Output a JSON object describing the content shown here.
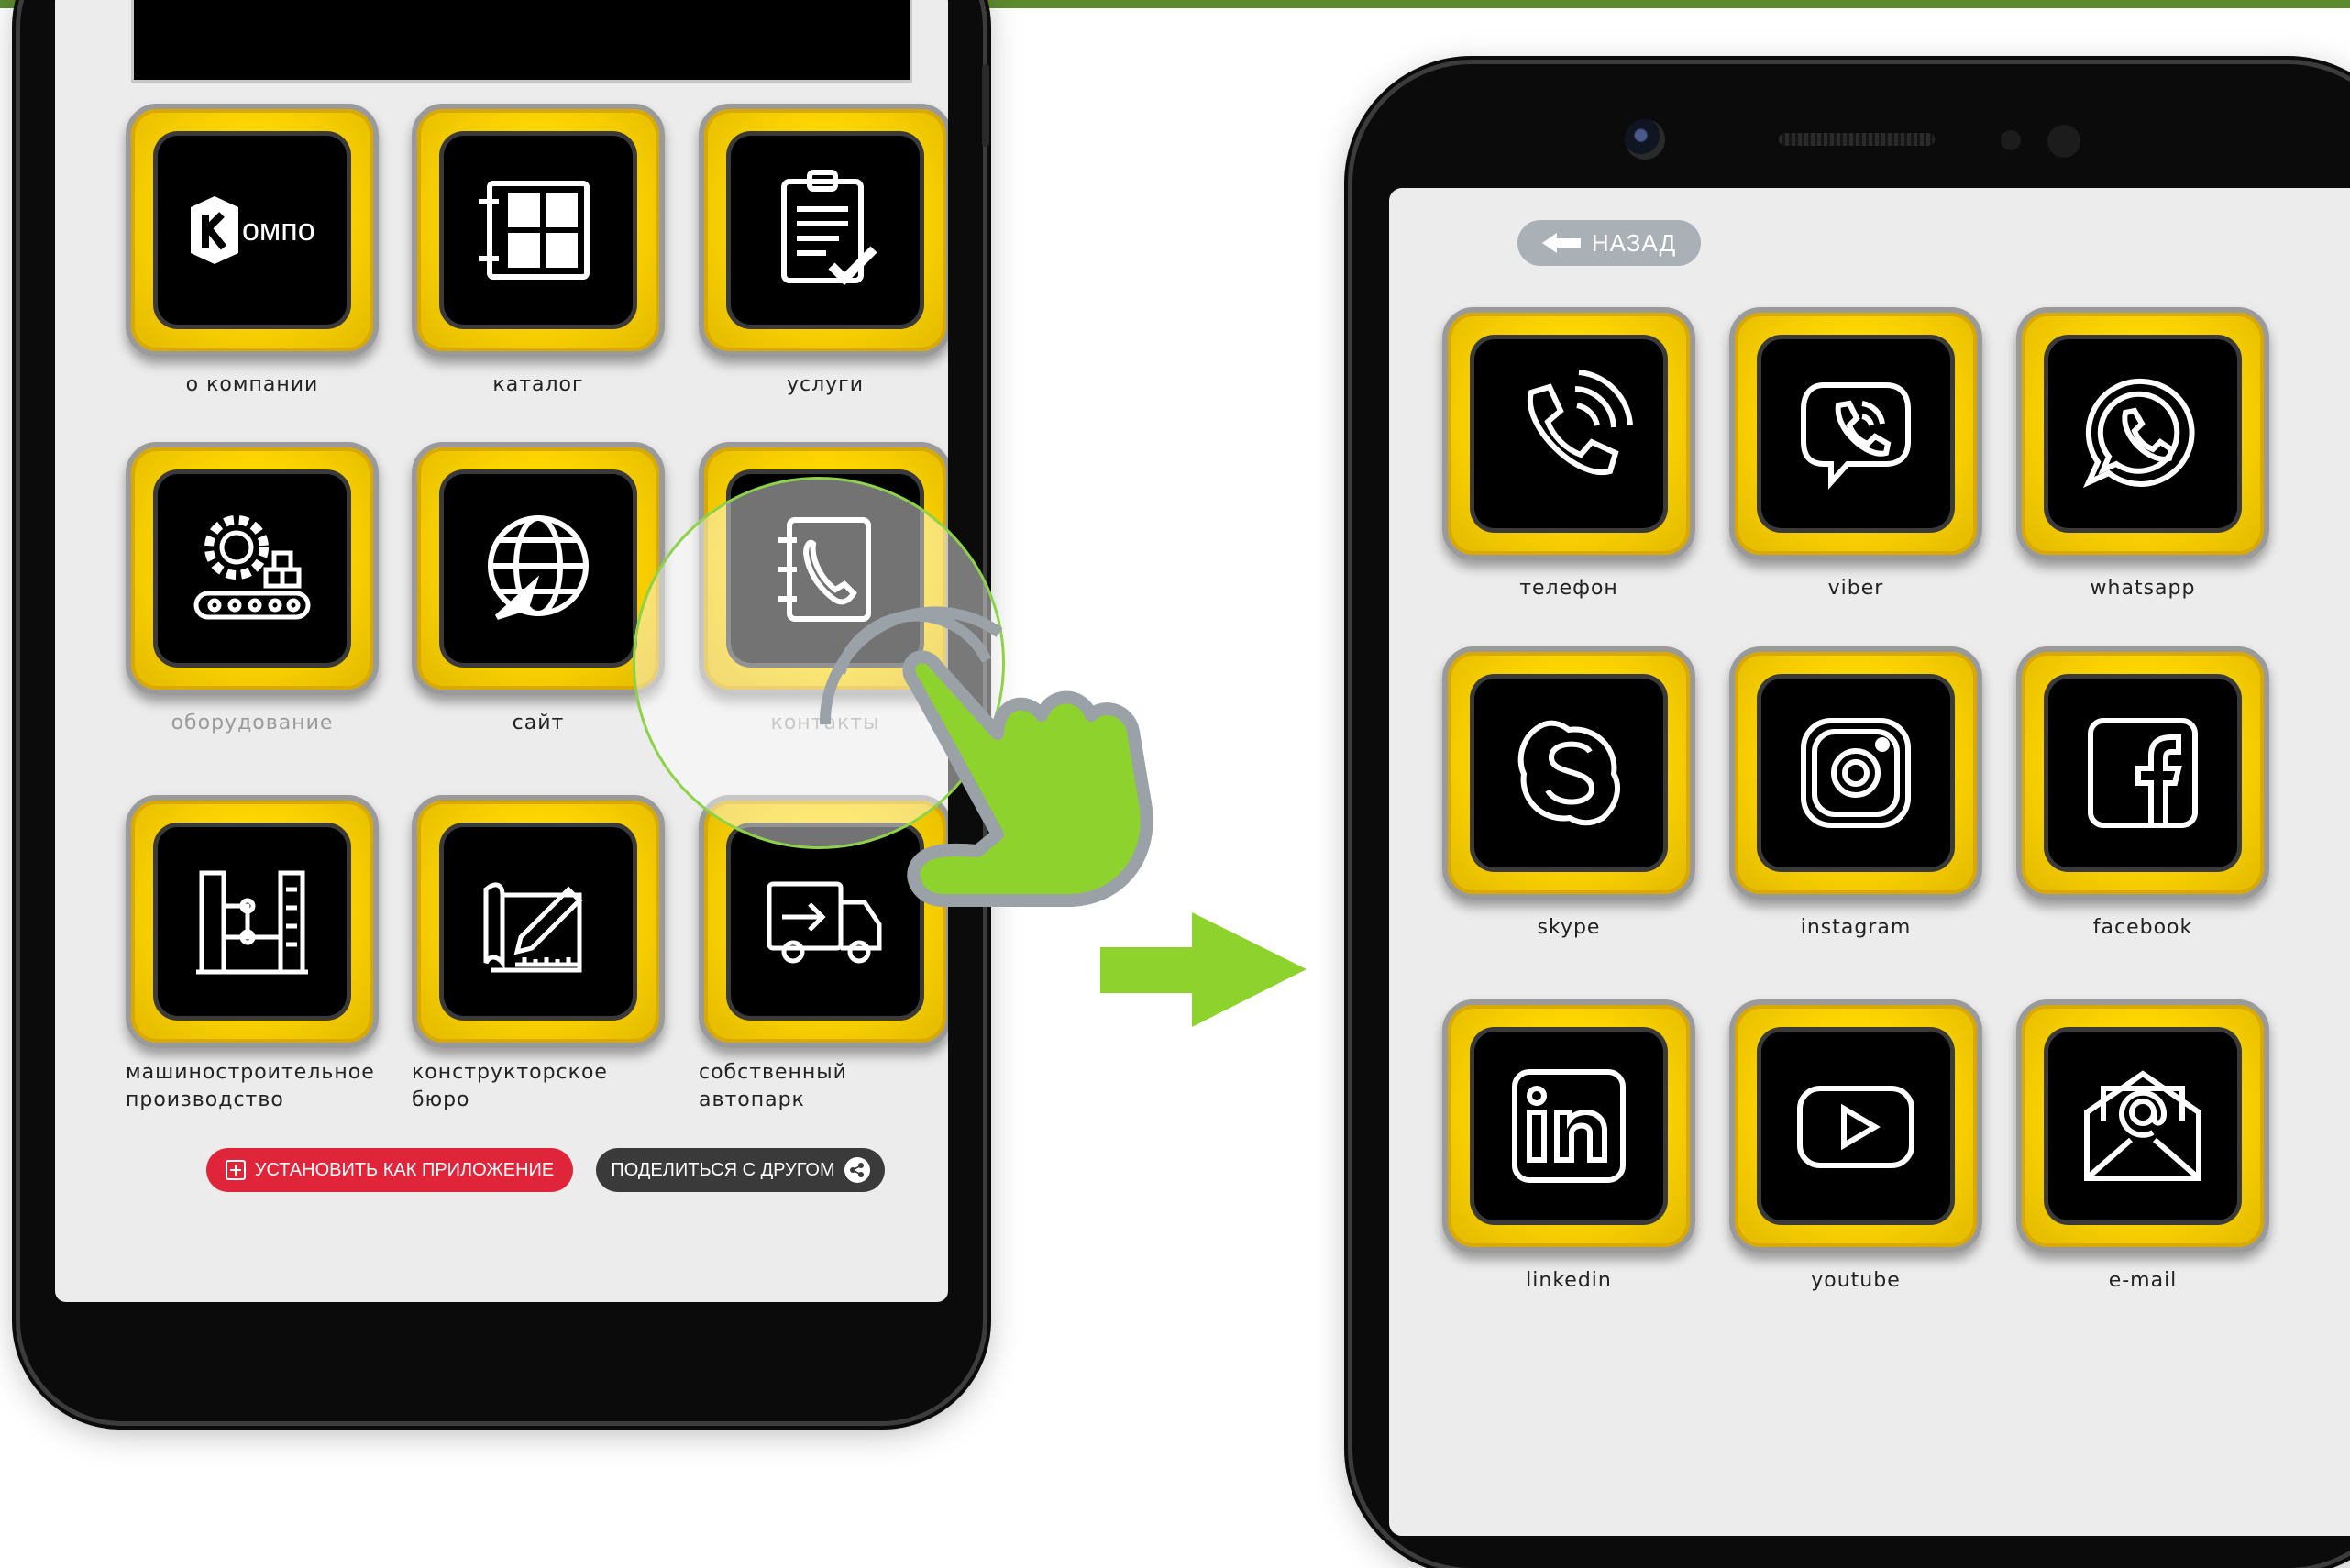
{
  "left_phone": {
    "tiles": [
      {
        "label": "о компании",
        "icon": "company-logo-icon",
        "logo_text": "омпо"
      },
      {
        "label": "каталог",
        "icon": "catalog-grid-icon"
      },
      {
        "label": "услуги",
        "icon": "clipboard-check-icon"
      },
      {
        "label": "оборудование",
        "icon": "gear-conveyor-icon"
      },
      {
        "label": "сайт",
        "icon": "globe-icon"
      },
      {
        "label": "контакты",
        "icon": "contacts-book-icon"
      },
      {
        "label": "машиностроительное производство",
        "icon": "factory-machine-icon"
      },
      {
        "label": "конструкторское бюро",
        "icon": "drafting-pencil-icon"
      },
      {
        "label": "собственный автопарк",
        "icon": "delivery-truck-icon"
      }
    ],
    "install_button": "УСТАНОВИТЬ КАК ПРИЛОЖЕНИЕ",
    "share_button": "ПОДЕЛИТЬСЯ С ДРУГОМ"
  },
  "right_phone": {
    "back_button": "НАЗАД",
    "tiles": [
      {
        "label": "телефон",
        "icon": "phone-icon"
      },
      {
        "label": "viber",
        "icon": "viber-icon"
      },
      {
        "label": "whatsapp",
        "icon": "whatsapp-icon"
      },
      {
        "label": "skype",
        "icon": "skype-icon"
      },
      {
        "label": "instagram",
        "icon": "instagram-icon"
      },
      {
        "label": "facebook",
        "icon": "facebook-icon"
      },
      {
        "label": "linkedin",
        "icon": "linkedin-icon"
      },
      {
        "label": "youtube",
        "icon": "youtube-icon"
      },
      {
        "label": "e-mail",
        "icon": "email-icon"
      }
    ]
  },
  "colors": {
    "accent_green": "#8ed24a",
    "tile_yellow": "#ffd800",
    "install_red": "#e0253a",
    "share_dark": "#3a3a3a",
    "back_gray": "#a9b1b6"
  }
}
